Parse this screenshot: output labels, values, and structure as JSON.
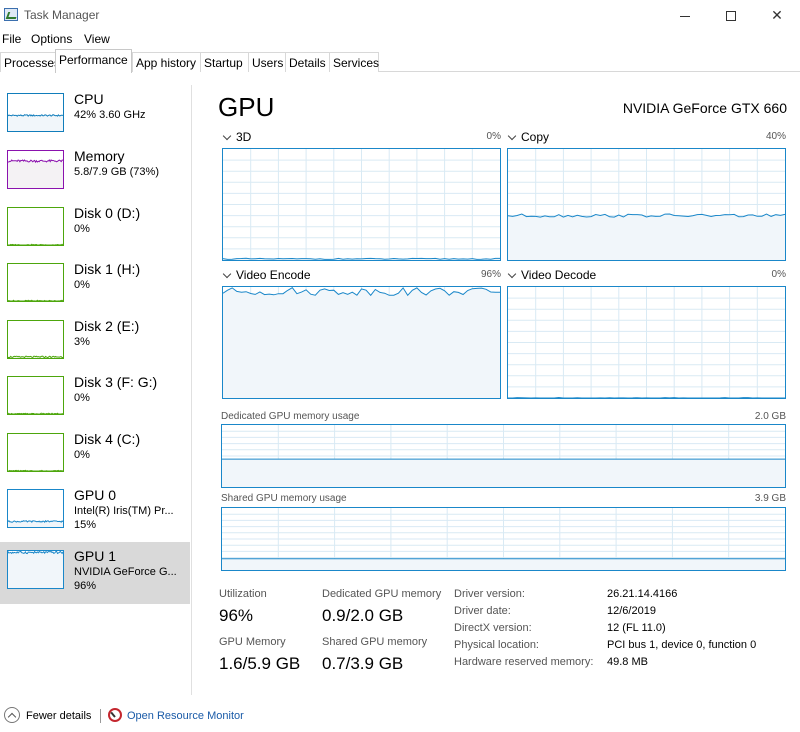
{
  "window": {
    "title": "Task Manager"
  },
  "menu": [
    "File",
    "Options",
    "View"
  ],
  "tabs": [
    "Processes",
    "Performance",
    "App history",
    "Startup",
    "Users",
    "Details",
    "Services"
  ],
  "active_tab": "Performance",
  "sidebar": [
    {
      "name": "CPU",
      "sub1": "42%  3.60 GHz",
      "color": "#117dbb",
      "level": 0.42
    },
    {
      "name": "Memory",
      "sub1": "5.8/7.9 GB (73%)",
      "color": "#8b12ae",
      "level": 0.73
    },
    {
      "name": "Disk 0 (D:)",
      "sub1": "0%",
      "color": "#4da60c",
      "level": 0
    },
    {
      "name": "Disk 1 (H:)",
      "sub1": "0%",
      "color": "#4da60c",
      "level": 0
    },
    {
      "name": "Disk 2 (E:)",
      "sub1": "3%",
      "color": "#4da60c",
      "level": 0.03
    },
    {
      "name": "Disk 3 (F: G:)",
      "sub1": "0%",
      "color": "#4da60c",
      "level": 0
    },
    {
      "name": "Disk 4 (C:)",
      "sub1": "0%",
      "color": "#4da60c",
      "level": 0
    },
    {
      "name": "GPU 0",
      "sub1": "Intel(R) Iris(TM) Pr...",
      "sub2": "15%",
      "color": "#1a87c9",
      "level": 0.15
    },
    {
      "name": "GPU 1",
      "sub1": "NVIDIA GeForce G...",
      "sub2": "96%",
      "color": "#1a87c9",
      "level": 0.96,
      "selected": true
    }
  ],
  "main": {
    "title": "GPU",
    "device": "NVIDIA GeForce GTX 660",
    "engines": [
      {
        "name": "3D",
        "percent": "0%",
        "level": 0.01
      },
      {
        "name": "Copy",
        "percent": "40%",
        "level": 0.4
      },
      {
        "name": "Video Encode",
        "percent": "96%",
        "level": 0.96
      },
      {
        "name": "Video Decode",
        "percent": "0%",
        "level": 0
      }
    ],
    "dedicated": {
      "label": "Dedicated GPU memory usage",
      "max": "2.0 GB",
      "level": 0.45
    },
    "shared": {
      "label": "Shared GPU memory usage",
      "max": "3.9 GB",
      "level": 0.18
    },
    "stats": {
      "utilization_label": "Utilization",
      "utilization_value": "96%",
      "dedicated_label": "Dedicated GPU memory",
      "dedicated_value": "0.9/2.0 GB",
      "gpu_memory_label": "GPU Memory",
      "gpu_memory_value": "1.6/5.9 GB",
      "shared_label": "Shared GPU memory",
      "shared_value": "0.7/3.9 GB"
    },
    "info": [
      {
        "label": "Driver version:",
        "value": "26.21.14.4166"
      },
      {
        "label": "Driver date:",
        "value": "12/6/2019"
      },
      {
        "label": "DirectX version:",
        "value": "12 (FL 11.0)"
      },
      {
        "label": "Physical location:",
        "value": "PCI bus 1, device 0, function 0"
      },
      {
        "label": "Hardware reserved memory:",
        "value": "49.8 MB"
      }
    ]
  },
  "footer": {
    "fewer_details": "Fewer details",
    "open_resource_monitor": "Open Resource Monitor"
  },
  "colors": {
    "gpu_line": "#1a87c9",
    "gpu_fill": "#f1f6fa",
    "grid": "#d9eaf4"
  }
}
